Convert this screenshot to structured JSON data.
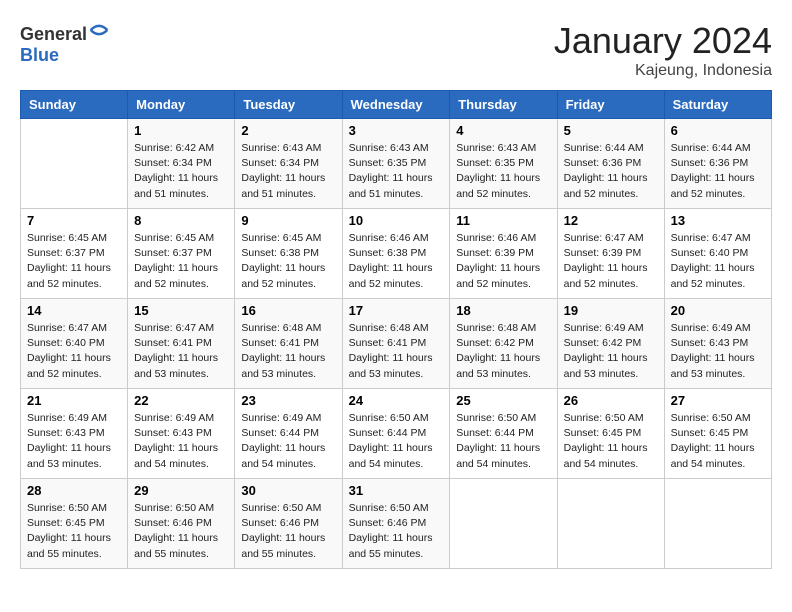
{
  "header": {
    "logo_general": "General",
    "logo_blue": "Blue",
    "month_title": "January 2024",
    "location": "Kajeung, Indonesia"
  },
  "weekdays": [
    "Sunday",
    "Monday",
    "Tuesday",
    "Wednesday",
    "Thursday",
    "Friday",
    "Saturday"
  ],
  "weeks": [
    [
      {
        "day": "",
        "info": ""
      },
      {
        "day": "1",
        "info": "Sunrise: 6:42 AM\nSunset: 6:34 PM\nDaylight: 11 hours and 51 minutes."
      },
      {
        "day": "2",
        "info": "Sunrise: 6:43 AM\nSunset: 6:34 PM\nDaylight: 11 hours and 51 minutes."
      },
      {
        "day": "3",
        "info": "Sunrise: 6:43 AM\nSunset: 6:35 PM\nDaylight: 11 hours and 51 minutes."
      },
      {
        "day": "4",
        "info": "Sunrise: 6:43 AM\nSunset: 6:35 PM\nDaylight: 11 hours and 52 minutes."
      },
      {
        "day": "5",
        "info": "Sunrise: 6:44 AM\nSunset: 6:36 PM\nDaylight: 11 hours and 52 minutes."
      },
      {
        "day": "6",
        "info": "Sunrise: 6:44 AM\nSunset: 6:36 PM\nDaylight: 11 hours and 52 minutes."
      }
    ],
    [
      {
        "day": "7",
        "info": "Sunrise: 6:45 AM\nSunset: 6:37 PM\nDaylight: 11 hours and 52 minutes."
      },
      {
        "day": "8",
        "info": "Sunrise: 6:45 AM\nSunset: 6:37 PM\nDaylight: 11 hours and 52 minutes."
      },
      {
        "day": "9",
        "info": "Sunrise: 6:45 AM\nSunset: 6:38 PM\nDaylight: 11 hours and 52 minutes."
      },
      {
        "day": "10",
        "info": "Sunrise: 6:46 AM\nSunset: 6:38 PM\nDaylight: 11 hours and 52 minutes."
      },
      {
        "day": "11",
        "info": "Sunrise: 6:46 AM\nSunset: 6:39 PM\nDaylight: 11 hours and 52 minutes."
      },
      {
        "day": "12",
        "info": "Sunrise: 6:47 AM\nSunset: 6:39 PM\nDaylight: 11 hours and 52 minutes."
      },
      {
        "day": "13",
        "info": "Sunrise: 6:47 AM\nSunset: 6:40 PM\nDaylight: 11 hours and 52 minutes."
      }
    ],
    [
      {
        "day": "14",
        "info": "Sunrise: 6:47 AM\nSunset: 6:40 PM\nDaylight: 11 hours and 52 minutes."
      },
      {
        "day": "15",
        "info": "Sunrise: 6:47 AM\nSunset: 6:41 PM\nDaylight: 11 hours and 53 minutes."
      },
      {
        "day": "16",
        "info": "Sunrise: 6:48 AM\nSunset: 6:41 PM\nDaylight: 11 hours and 53 minutes."
      },
      {
        "day": "17",
        "info": "Sunrise: 6:48 AM\nSunset: 6:41 PM\nDaylight: 11 hours and 53 minutes."
      },
      {
        "day": "18",
        "info": "Sunrise: 6:48 AM\nSunset: 6:42 PM\nDaylight: 11 hours and 53 minutes."
      },
      {
        "day": "19",
        "info": "Sunrise: 6:49 AM\nSunset: 6:42 PM\nDaylight: 11 hours and 53 minutes."
      },
      {
        "day": "20",
        "info": "Sunrise: 6:49 AM\nSunset: 6:43 PM\nDaylight: 11 hours and 53 minutes."
      }
    ],
    [
      {
        "day": "21",
        "info": "Sunrise: 6:49 AM\nSunset: 6:43 PM\nDaylight: 11 hours and 53 minutes."
      },
      {
        "day": "22",
        "info": "Sunrise: 6:49 AM\nSunset: 6:43 PM\nDaylight: 11 hours and 54 minutes."
      },
      {
        "day": "23",
        "info": "Sunrise: 6:49 AM\nSunset: 6:44 PM\nDaylight: 11 hours and 54 minutes."
      },
      {
        "day": "24",
        "info": "Sunrise: 6:50 AM\nSunset: 6:44 PM\nDaylight: 11 hours and 54 minutes."
      },
      {
        "day": "25",
        "info": "Sunrise: 6:50 AM\nSunset: 6:44 PM\nDaylight: 11 hours and 54 minutes."
      },
      {
        "day": "26",
        "info": "Sunrise: 6:50 AM\nSunset: 6:45 PM\nDaylight: 11 hours and 54 minutes."
      },
      {
        "day": "27",
        "info": "Sunrise: 6:50 AM\nSunset: 6:45 PM\nDaylight: 11 hours and 54 minutes."
      }
    ],
    [
      {
        "day": "28",
        "info": "Sunrise: 6:50 AM\nSunset: 6:45 PM\nDaylight: 11 hours and 55 minutes."
      },
      {
        "day": "29",
        "info": "Sunrise: 6:50 AM\nSunset: 6:46 PM\nDaylight: 11 hours and 55 minutes."
      },
      {
        "day": "30",
        "info": "Sunrise: 6:50 AM\nSunset: 6:46 PM\nDaylight: 11 hours and 55 minutes."
      },
      {
        "day": "31",
        "info": "Sunrise: 6:50 AM\nSunset: 6:46 PM\nDaylight: 11 hours and 55 minutes."
      },
      {
        "day": "",
        "info": ""
      },
      {
        "day": "",
        "info": ""
      },
      {
        "day": "",
        "info": ""
      }
    ]
  ]
}
